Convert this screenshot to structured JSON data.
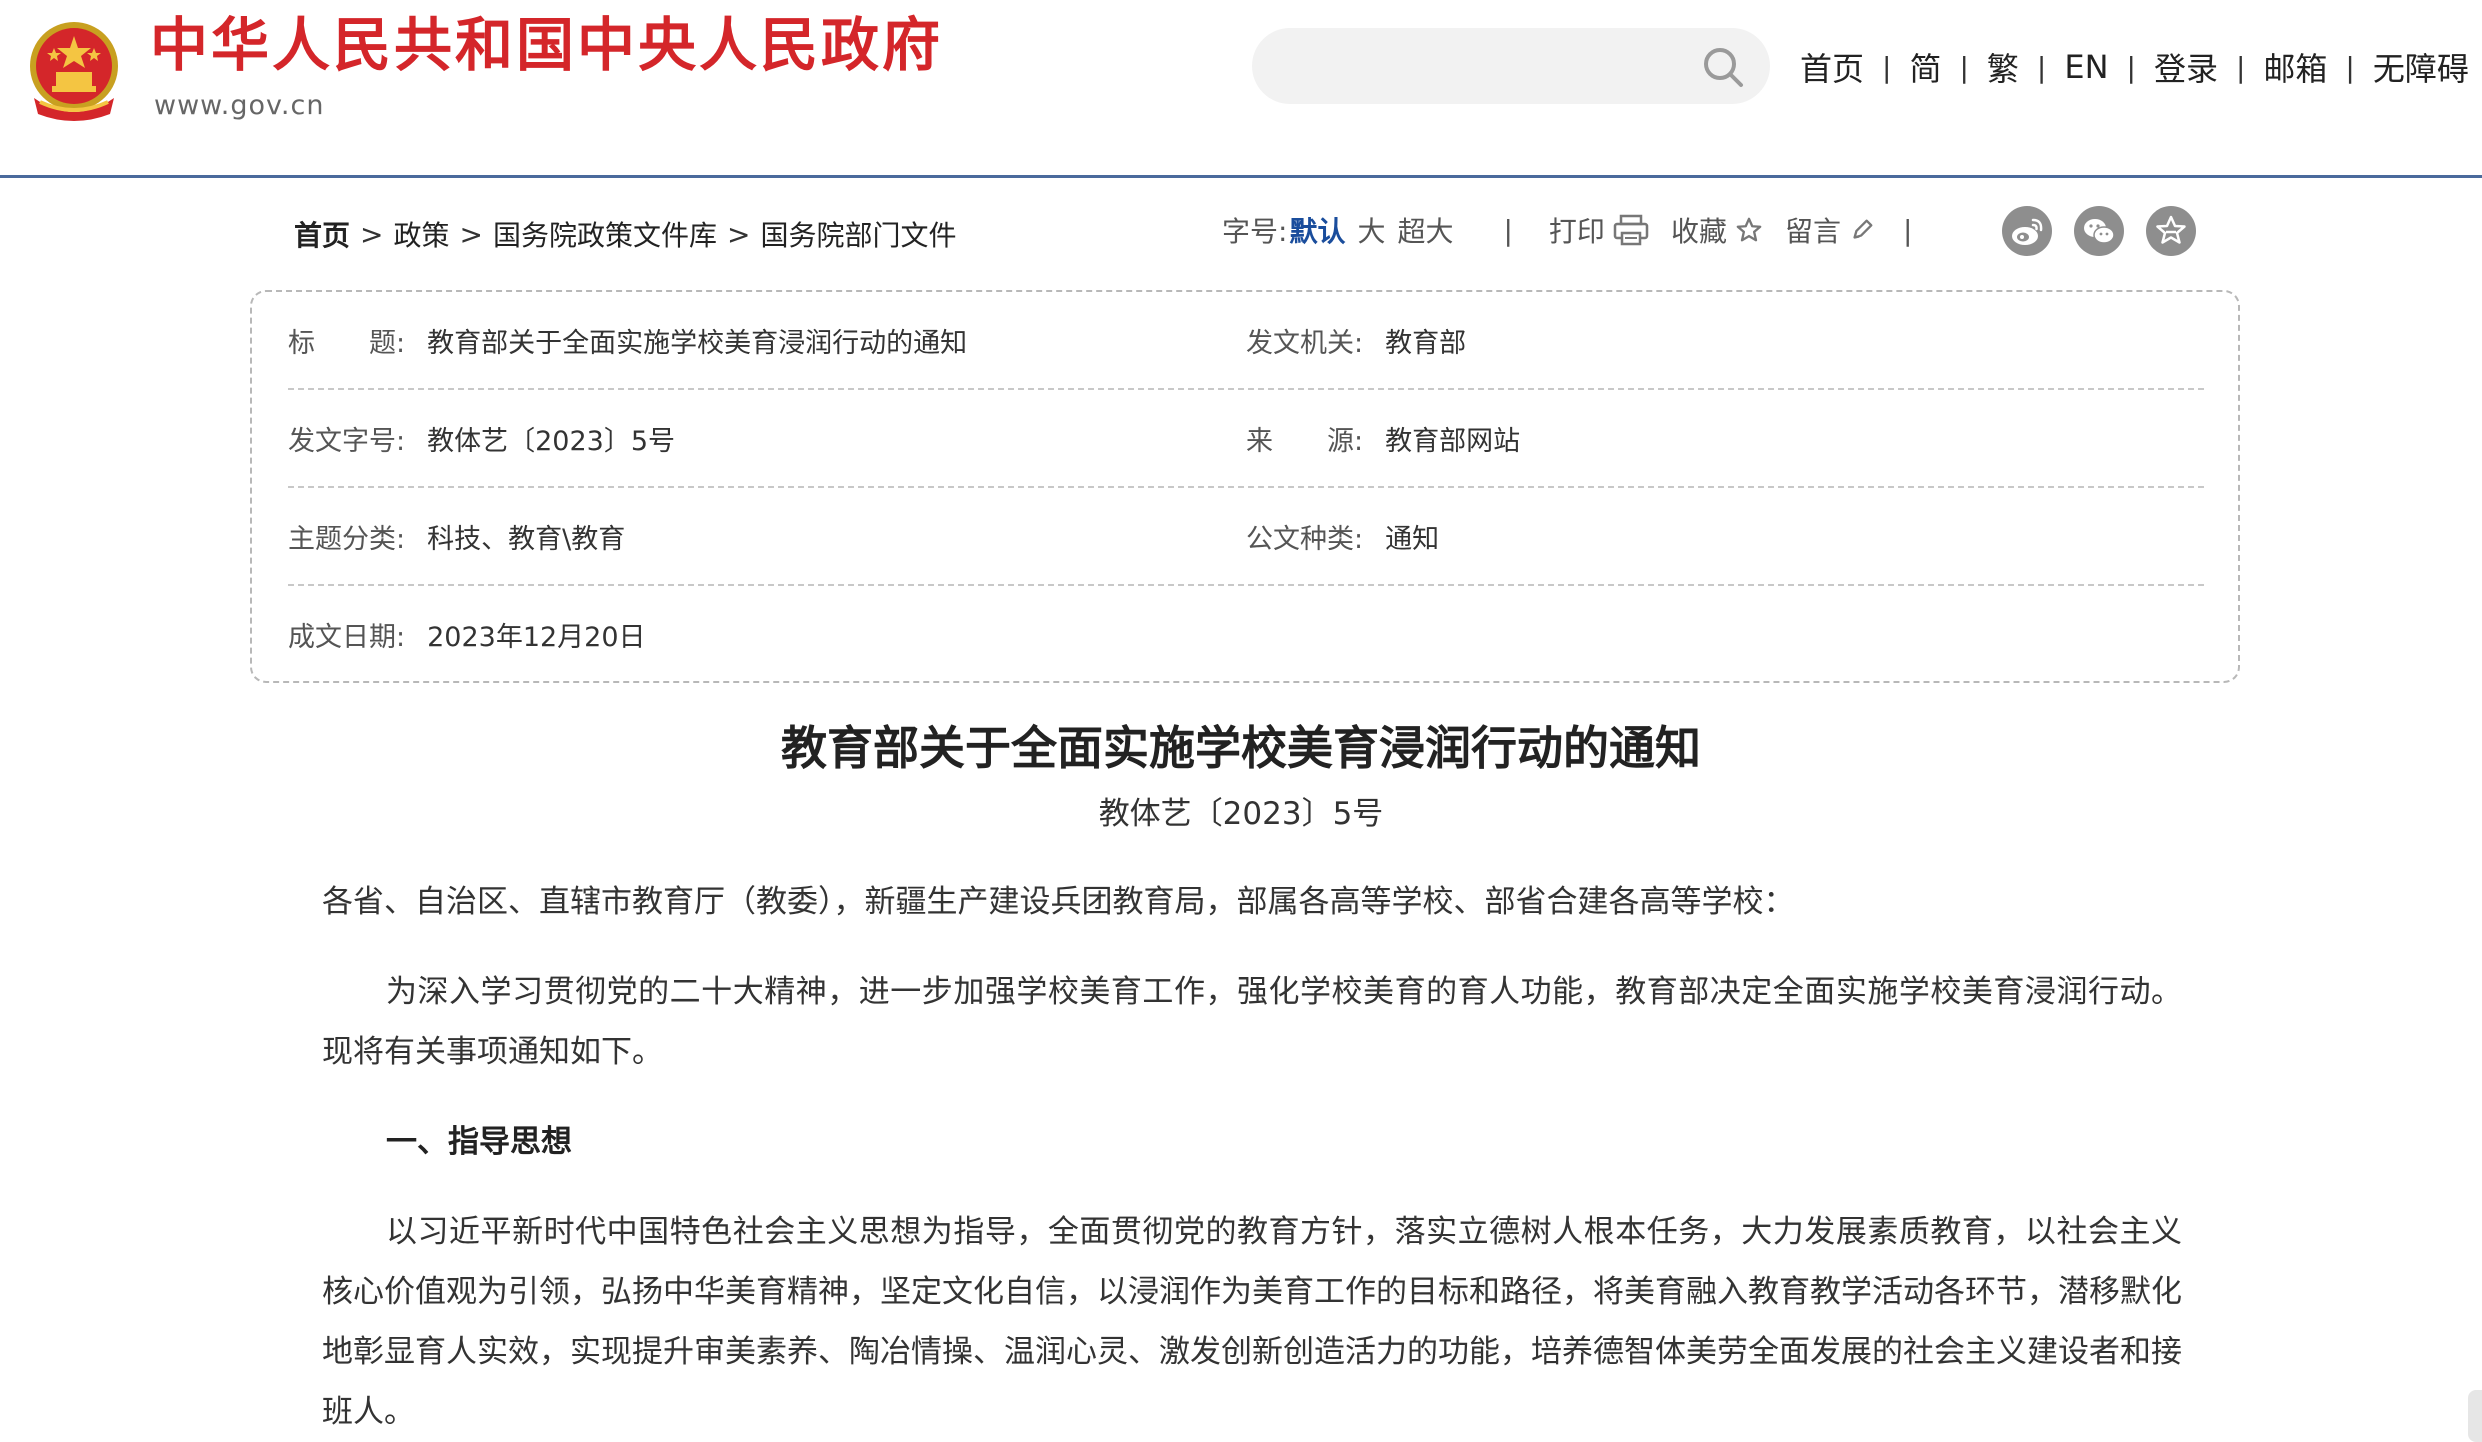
{
  "header": {
    "site_title": "中华人民共和国中央人民政府",
    "site_url": "www.gov.cn",
    "search_placeholder": "",
    "nav": {
      "home": "首页",
      "simplified": "简",
      "traditional": "繁",
      "english": "EN",
      "login": "登录",
      "mailbox": "邮箱",
      "accessibility": "无障碍",
      "separator": "|"
    }
  },
  "breadcrumb": {
    "home": "首页",
    "policy": "政策",
    "library": "国务院政策文件库",
    "department": "国务院部门文件",
    "sep": ">"
  },
  "tools": {
    "font_size_label": "字号:",
    "font_default": "默认",
    "font_large": "大",
    "font_xlarge": "超大",
    "sep": "|",
    "print": "打印",
    "favorite": "收藏",
    "comment": "留言"
  },
  "info": {
    "title_label": "标　　题:",
    "title_value": "教育部关于全面实施学校美育浸润行动的通知",
    "issuer_label": "发文机关:",
    "issuer_value": "教育部",
    "doc_no_label": "发文字号:",
    "doc_no_value": "教体艺〔2023〕5号",
    "source_label": "来　　源:",
    "source_value": "教育部网站",
    "topic_label": "主题分类:",
    "topic_value": "科技、教育\\教育",
    "type_label": "公文种类:",
    "type_value": "通知",
    "date_label": "成文日期:",
    "date_value": "2023年12月20日"
  },
  "article": {
    "title": "教育部关于全面实施学校美育浸润行动的通知",
    "doc_number": "教体艺〔2023〕5号",
    "salutation": "各省、自治区、直辖市教育厅（教委），新疆生产建设兵团教育局，部属各高等学校、部省合建各高等学校：",
    "para1": "为深入学习贯彻党的二十大精神，进一步加强学校美育工作，强化学校美育的育人功能，教育部决定全面实施学校美育浸润行动。现将有关事项通知如下。",
    "heading1": "一、指导思想",
    "para2": "以习近平新时代中国特色社会主义思想为指导，全面贯彻党的教育方针，落实立德树人根本任务，大力发展素质教育，以社会主义核心价值观为引领，弘扬中华美育精神，坚定文化自信，以浸润作为美育工作的目标和路径，将美育融入教育教学活动各环节，潜移默化地彰显育人实效，实现提升审美素养、陶冶情操、温润心灵、激发创新创造活力的功能，培养德智体美劳全面发展的社会主义建设者和接班人。"
  },
  "colors": {
    "brand_red": "#d4262a",
    "link_blue": "#1a4d9c",
    "header_rule": "#4a6a9c",
    "icon_grey": "#8e8e8e"
  },
  "icons": [
    "national-emblem-icon",
    "search-icon",
    "printer-icon",
    "star-icon",
    "pencil-icon",
    "weibo-icon",
    "wechat-icon",
    "favorite-share-icon"
  ]
}
